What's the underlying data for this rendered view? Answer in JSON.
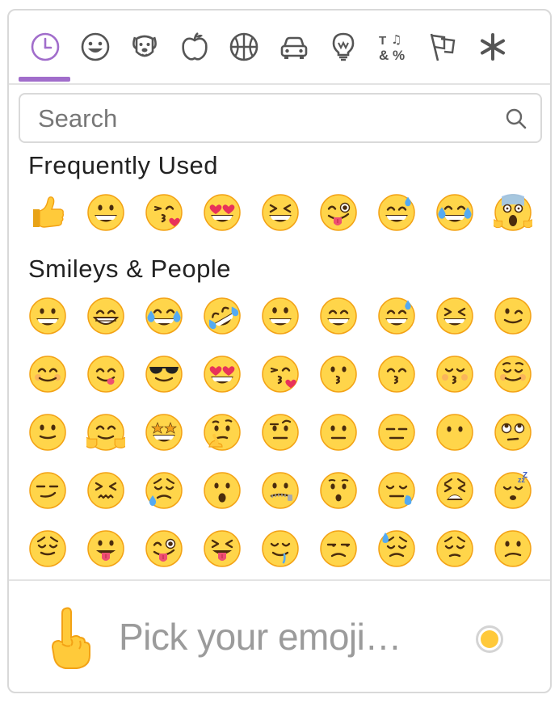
{
  "colors": {
    "accent": "#a16dcb",
    "icon": "#555555",
    "skin_default": "#ffc93a"
  },
  "nav": {
    "tabs": [
      {
        "name": "tab-frequently-used",
        "icon": "clock-icon",
        "active": true
      },
      {
        "name": "tab-smileys-people",
        "icon": "smiley-icon"
      },
      {
        "name": "tab-animals-nature",
        "icon": "dog-icon"
      },
      {
        "name": "tab-food-drink",
        "icon": "apple-icon"
      },
      {
        "name": "tab-activity",
        "icon": "basketball-icon"
      },
      {
        "name": "tab-travel-places",
        "icon": "car-icon"
      },
      {
        "name": "tab-objects",
        "icon": "lightbulb-icon"
      },
      {
        "name": "tab-symbols",
        "icon": "symbols-icon"
      },
      {
        "name": "tab-flags",
        "icon": "flags-icon"
      },
      {
        "name": "tab-custom",
        "icon": "asterisk-icon"
      }
    ]
  },
  "search": {
    "placeholder": "Search",
    "value": ""
  },
  "categories": [
    {
      "title": "Frequently Used",
      "emojis": [
        "thumbs-up",
        "grinning",
        "kissing-heart",
        "heart-eyes",
        "laughing",
        "stuck-out-tongue-winking",
        "sweat-smile",
        "joy",
        "scream"
      ]
    },
    {
      "title": "Smileys & People",
      "emojis": [
        "grinning",
        "grin",
        "joy",
        "rofl",
        "smiley",
        "smile",
        "sweat-smile",
        "laughing",
        "wink",
        "blush",
        "yum",
        "sunglasses",
        "heart-eyes",
        "kissing-heart",
        "kissing",
        "kissing-smiling-eyes",
        "kissing-closed-eyes",
        "relaxed",
        "slightly-smiling",
        "hugging",
        "star-struck",
        "thinking",
        "raised-eyebrow",
        "neutral",
        "expressionless",
        "no-mouth",
        "rolling-eyes",
        "smirk",
        "persevere",
        "disappointed-relieved",
        "open-mouth",
        "zipper-mouth",
        "hushed",
        "sleepy",
        "tired",
        "sleeping",
        "relieved",
        "stuck-out-tongue",
        "stuck-out-tongue-winking",
        "stuck-out-tongue-closed-eyes",
        "drooling",
        "unamused",
        "sweat",
        "pensive",
        "confused"
      ]
    }
  ],
  "preview": {
    "emoji": "point-up",
    "text": "Pick your emoji…"
  }
}
